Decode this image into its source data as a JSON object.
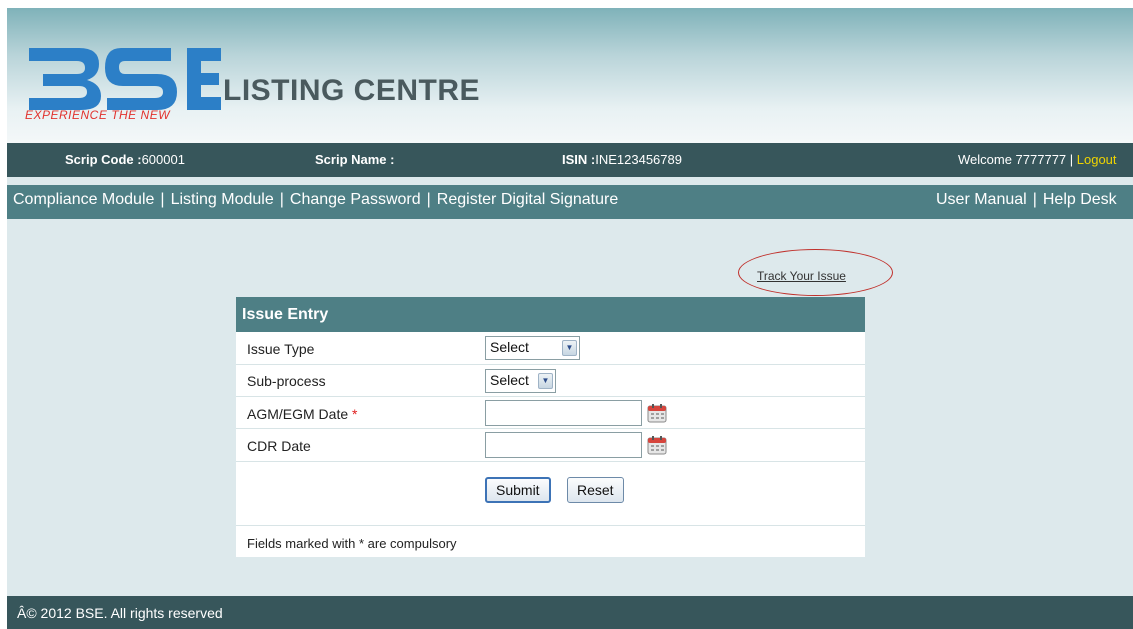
{
  "header": {
    "logo_text": "BSE",
    "tagline": "EXPERIENCE THE NEW",
    "site_title": "LISTING CENTRE",
    "logo_color": "#2c7fc7",
    "tagline_color": "#e2332e"
  },
  "infobar": {
    "scrip_code_label": "Scrip Code :",
    "scrip_code_value": "600001",
    "scrip_name_label": "Scrip Name :",
    "scrip_name_value": "",
    "isin_label": "ISIN :",
    "isin_value": "INE123456789",
    "welcome": "Welcome 7777777 | ",
    "logout": "Logout"
  },
  "nav": {
    "left": [
      "Compliance Module",
      "Listing Module",
      "Change Password",
      "Register Digital Signature"
    ],
    "right": [
      "User Manual",
      "Help Desk"
    ],
    "separator": "|"
  },
  "track_link": "Track Your Issue",
  "form": {
    "title": "Issue Entry",
    "issue_type_label": "Issue Type",
    "issue_type_value": "Select",
    "subprocess_label": "Sub-process",
    "subprocess_value": "Select",
    "agm_label": "AGM/EGM Date",
    "required_marker": "*",
    "agm_value": "",
    "cdr_label": "CDR Date",
    "cdr_value": "",
    "submit_label": "Submit",
    "reset_label": "Reset",
    "footnote": "Fields marked with * are compulsory"
  },
  "footer": {
    "copyright": "Â© 2012 BSE. All rights reserved"
  },
  "colors": {
    "infobar_bg": "#37565b",
    "navbar_bg": "#4e7f85",
    "page_bg": "#dde9ec",
    "logout": "#f0d400",
    "annotation_oval": "#c0302b"
  },
  "icons": {
    "calendar": "calendar-icon",
    "dropdown": "chevron-down-icon"
  }
}
